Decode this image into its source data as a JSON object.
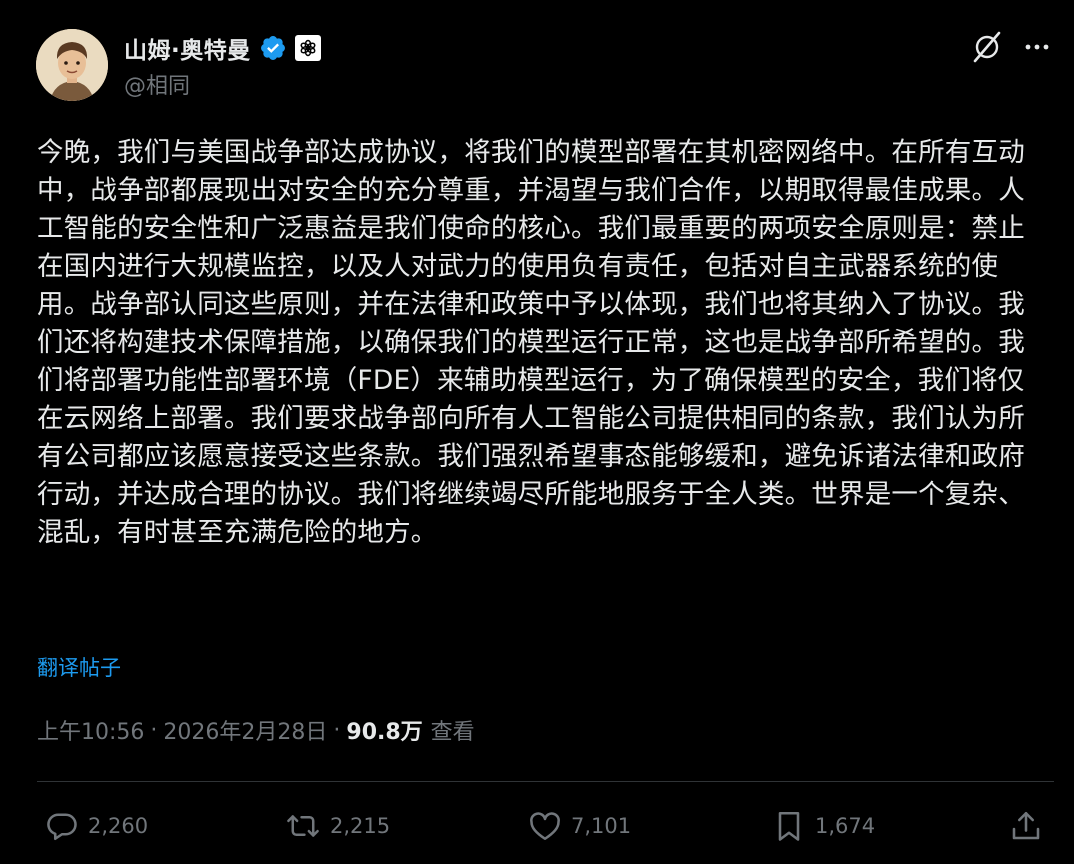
{
  "author": {
    "display_name": "山姆·奥特曼",
    "handle": "@相同",
    "avatar_icon": "cartoon-avatar",
    "verified_color": "#1d9bf0"
  },
  "post": {
    "text": "今晚，我们与美国战争部达成协议，将我们的模型部署在其机密网络中。在所有互动中，战争部都展现出对安全的充分尊重，并渴望与我们合作，以期取得最佳成果。人工智能的安全性和广泛惠益是我们使命的核心。我们最重要的两项安全原则是：禁止在国内进行大规模监控，以及人对武力的使用负有责任，包括对自主武器系统的使用。战争部认同这些原则，并在法律和政策中予以体现，我们也将其纳入了协议。我们还将构建技术保障措施，以确保我们的模型运行正常，这也是战争部所希望的。我们将部署功能性部署环境（FDE）来辅助模型运行，为了确保模型的安全，我们将仅在云网络上部署。我们要求战争部向所有人工智能公司提供相同的条款，我们认为所有公司都应该愿意接受这些条款。我们强烈希望事态能够缓和，避免诉诸法律和政府行动，并达成合理的协议。我们将继续竭尽所能地服务于全人类。世界是一个复杂、混乱，有时甚至充满危险的地方。",
    "translate_label": "翻译帖子",
    "time": "上午10:56",
    "date": "2026年2月28日",
    "separator": "·",
    "views_count": "90.8万",
    "views_label": "查看"
  },
  "actions": {
    "replies": "2,260",
    "reposts": "2,215",
    "likes": "7,101",
    "bookmarks": "1,674"
  },
  "colors": {
    "background": "#000000",
    "text": "#e7e9ea",
    "muted": "#71767b",
    "link": "#1d9bf0",
    "divider": "#2f3336"
  }
}
